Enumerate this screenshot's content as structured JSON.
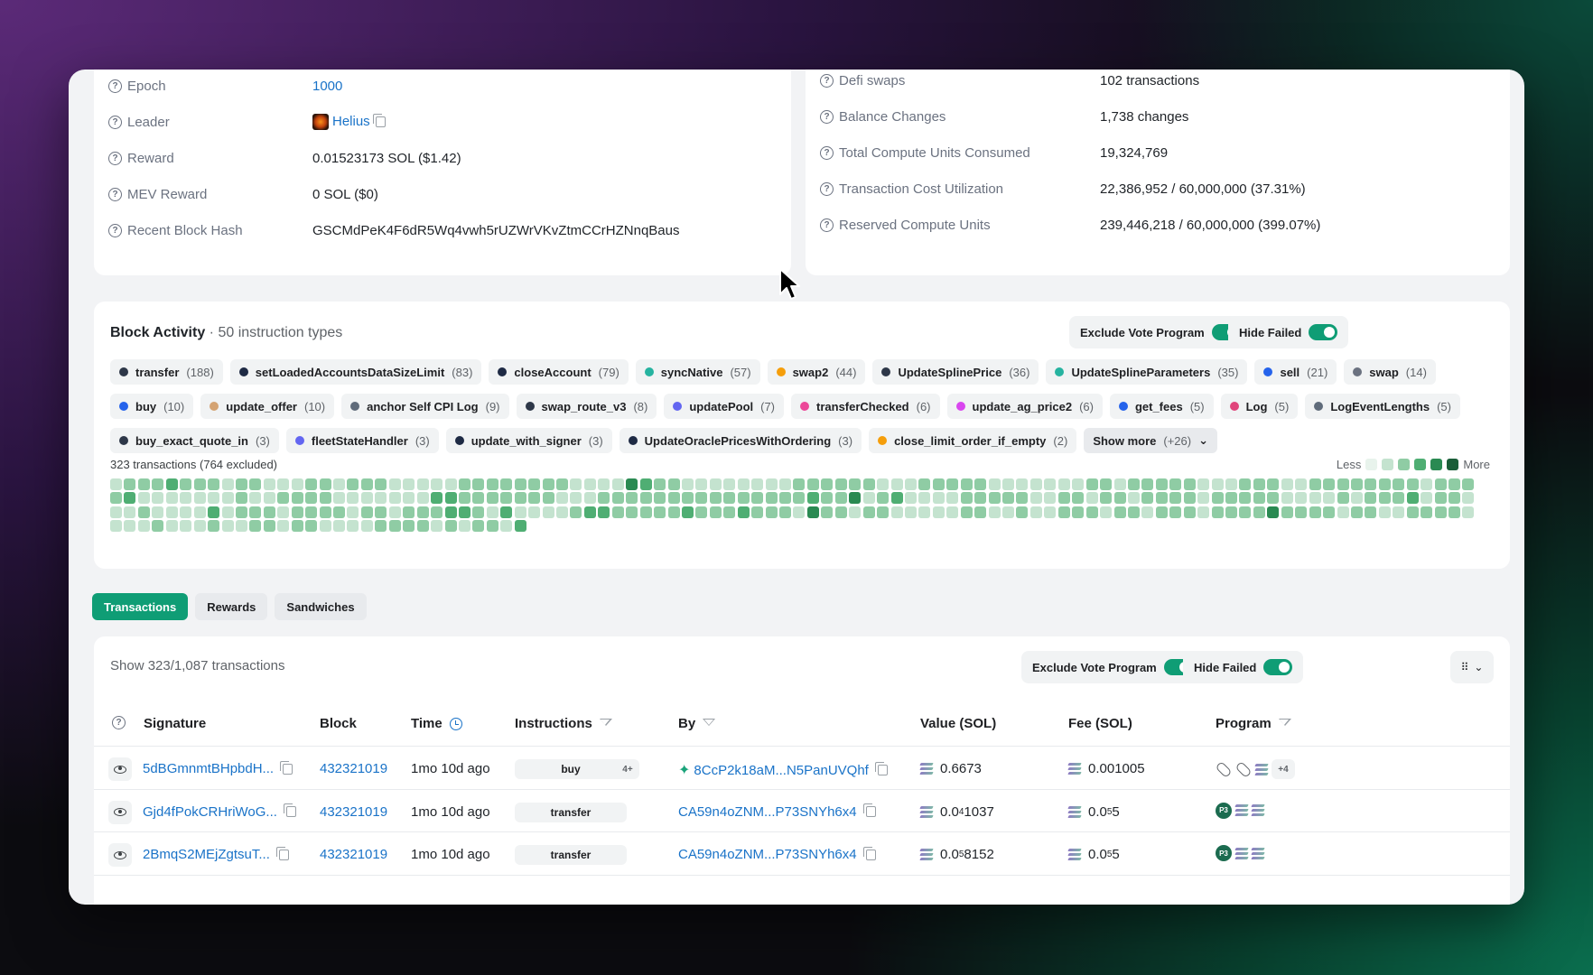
{
  "block_info_left": [
    {
      "label": "Epoch",
      "value": "1000",
      "link": true
    },
    {
      "label": "Leader",
      "value": "Helius",
      "link": true,
      "logo": true,
      "copy": true
    },
    {
      "label": "Reward",
      "value": "0.01523173 SOL ($1.42)"
    },
    {
      "label": "MEV Reward",
      "value": "0 SOL ($0)"
    },
    {
      "label": "Recent Block Hash",
      "value": "GSCMdPeK4F6dR5Wq4vwh5rUZWrVKvZtmCCrHZNnqBaus"
    }
  ],
  "block_info_right": [
    {
      "label": "Defi swaps",
      "value": "102 transactions"
    },
    {
      "label": "Balance Changes",
      "value": "1,738 changes"
    },
    {
      "label": "Total Compute Units Consumed",
      "value": "19,324,769"
    },
    {
      "label": "Transaction Cost Utilization",
      "value": "22,386,952 / 60,000,000 (37.31%)"
    },
    {
      "label": "Reserved Compute Units",
      "value": "239,446,218 / 60,000,000 (399.07%)"
    }
  ],
  "activity": {
    "title": "Block Activity",
    "subtitle": "· 50 instruction types",
    "exclude_vote_label": "Exclude Vote Program",
    "hide_failed_label": "Hide Failed",
    "summary": "323 transactions (764 excluded)",
    "legend_less": "Less",
    "legend_more": "More",
    "legend_colors": [
      "#e8f3ec",
      "#c4e3cf",
      "#8fcca4",
      "#4fae73",
      "#2a8a52",
      "#1a5e38"
    ],
    "chip_rows": [
      [
        {
          "name": "transfer",
          "count": "(188)",
          "color": "#2d3748"
        },
        {
          "name": "setLoadedAccountsDataSizeLimit",
          "count": "(83)",
          "color": "#1e2a44"
        },
        {
          "name": "closeAccount",
          "count": "(79)",
          "color": "#1e2a44"
        },
        {
          "name": "syncNative",
          "count": "(57)",
          "color": "#26b3a0"
        },
        {
          "name": "swap2",
          "count": "(44)",
          "color": "#f59e0b"
        },
        {
          "name": "UpdateSplinePrice",
          "count": "(36)",
          "color": "#2d3748"
        },
        {
          "name": "UpdateSplineParameters",
          "count": "(35)",
          "color": "#26b3a0"
        },
        {
          "name": "sell",
          "count": "(21)",
          "color": "#2563eb"
        },
        {
          "name": "swap",
          "count": "(14)",
          "color": "#6b7280"
        }
      ],
      [
        {
          "name": "buy",
          "count": "(10)",
          "color": "#2563eb"
        },
        {
          "name": "update_offer",
          "count": "(10)",
          "color": "#d4a373"
        },
        {
          "name": "anchor Self CPI Log",
          "count": "(9)",
          "color": "#5f6b7a"
        },
        {
          "name": "swap_route_v3",
          "count": "(8)",
          "color": "#2d3748"
        },
        {
          "name": "updatePool",
          "count": "(7)",
          "color": "#6366f1"
        },
        {
          "name": "transferChecked",
          "count": "(6)",
          "color": "#ec4899"
        },
        {
          "name": "update_ag_price2",
          "count": "(6)",
          "color": "#d946ef"
        },
        {
          "name": "get_fees",
          "count": "(5)",
          "color": "#2563eb"
        },
        {
          "name": "Log",
          "count": "(5)",
          "color": "#e0457b"
        },
        {
          "name": "LogEventLengths",
          "count": "(5)",
          "color": "#5f6b7a"
        }
      ],
      [
        {
          "name": "buy_exact_quote_in",
          "count": "(3)",
          "color": "#2d3748"
        },
        {
          "name": "fleetStateHandler",
          "count": "(3)",
          "color": "#6366f1"
        },
        {
          "name": "update_with_signer",
          "count": "(3)",
          "color": "#1e2a44"
        },
        {
          "name": "UpdateOraclePricesWithOrdering",
          "count": "(3)",
          "color": "#1e2a44"
        },
        {
          "name": "close_limit_order_if_empty",
          "count": "(2)",
          "color": "#f59e0b"
        }
      ]
    ],
    "show_more_label": "Show more",
    "show_more_count": "(+26)"
  },
  "tabs": [
    "Transactions",
    "Rewards",
    "Sandwiches"
  ],
  "active_tab": "Transactions",
  "transactions": {
    "show_text": "Show 323/1,087 transactions",
    "exclude_vote_label": "Exclude Vote Program",
    "hide_failed_label": "Hide Failed",
    "columns": [
      "Signature",
      "Block",
      "Time",
      "Instructions",
      "By",
      "Value (SOL)",
      "Fee (SOL)",
      "Program"
    ],
    "rows": [
      {
        "signature": "5dBGmnmtBHpbdH...",
        "block": "432321019",
        "time": "1mo 10d ago",
        "instruction": "buy",
        "extra_instr": "4+",
        "by": "8CcP2k18aM...N5PanUVQhf",
        "by_sparkle": true,
        "value_main": "0.6673",
        "value_sub": "",
        "value_tail": "",
        "fee_main": "0.001005",
        "fee_sub": "",
        "fee_tail": "",
        "programs": [
          "pill-icon",
          "pill-icon",
          "solana-icon"
        ],
        "programs_more": "+4"
      },
      {
        "signature": "Gjd4fPokCRHriWoG...",
        "block": "432321019",
        "time": "1mo 10d ago",
        "instruction": "transfer",
        "extra_instr": "",
        "by": "CA59n4oZNM...P73SNYh6x4",
        "by_sparkle": false,
        "value_main": "0.0",
        "value_sub": "4",
        "value_tail": "1037",
        "fee_main": "0.0",
        "fee_sub": "5",
        "fee_tail": "5",
        "programs": [
          "p3-icon",
          "solana-icon",
          "solana-icon"
        ],
        "programs_more": ""
      },
      {
        "signature": "2BmqS2MEjZgtsuT...",
        "block": "432321019",
        "time": "1mo 10d ago",
        "instruction": "transfer",
        "extra_instr": "",
        "by": "CA59n4oZNM...P73SNYh6x4",
        "by_sparkle": false,
        "value_main": "0.0",
        "value_sub": "5",
        "value_tail": "8152",
        "fee_main": "0.0",
        "fee_sub": "5",
        "fee_tail": "5",
        "programs": [
          "p3-icon",
          "solana-icon",
          "solana-icon"
        ],
        "programs_more": ""
      }
    ]
  },
  "heatmap_levels": [
    [
      1,
      2,
      2,
      2,
      3,
      2,
      2,
      2,
      1,
      2,
      2,
      1,
      1,
      1,
      2,
      2,
      1,
      2,
      2,
      2,
      1,
      1,
      1,
      1,
      1,
      2,
      2,
      2,
      2,
      2,
      2,
      2,
      2,
      1,
      1,
      1,
      1,
      4,
      3,
      2,
      2,
      1,
      1,
      1,
      1,
      1,
      1,
      1,
      1,
      2,
      2,
      2,
      2,
      2,
      2,
      1,
      1,
      1,
      2,
      2,
      2,
      2,
      2,
      1,
      1,
      1,
      1,
      1,
      1,
      1,
      2,
      2,
      1,
      2,
      2,
      2,
      2,
      2,
      1,
      1,
      1,
      2,
      2,
      2,
      1,
      1,
      2,
      2,
      2,
      2,
      2,
      2,
      2,
      2,
      1,
      2,
      2,
      2
    ],
    [
      2,
      3,
      1,
      1,
      1,
      1,
      1,
      1,
      1,
      2,
      1,
      1,
      2,
      2,
      2,
      2,
      1,
      1,
      1,
      1,
      1,
      1,
      1,
      3,
      3,
      2,
      2,
      2,
      2,
      2,
      2,
      2,
      1,
      1,
      1,
      2,
      2,
      2,
      2,
      2,
      2,
      2,
      2,
      2,
      2,
      2,
      2,
      2,
      2,
      2,
      3,
      2,
      2,
      4,
      1,
      2,
      3,
      1,
      1,
      1,
      1,
      2,
      2,
      2,
      2,
      2,
      1,
      1,
      2,
      2,
      1,
      2,
      2,
      1,
      2,
      2,
      2,
      2,
      1,
      2,
      2,
      2,
      2,
      2,
      1,
      1,
      1,
      1,
      2,
      1,
      2,
      2,
      2,
      3,
      1,
      2,
      2,
      1
    ],
    [
      1,
      1,
      2,
      1,
      1,
      1,
      1,
      3,
      1,
      2,
      2,
      2,
      1,
      2,
      2,
      2,
      2,
      1,
      2,
      2,
      1,
      2,
      2,
      2,
      3,
      3,
      2,
      1,
      3,
      1,
      1,
      1,
      1,
      2,
      3,
      3,
      2,
      2,
      2,
      2,
      2,
      3,
      2,
      2,
      2,
      3,
      2,
      2,
      2,
      1,
      4,
      2,
      2,
      1,
      2,
      2,
      1,
      1,
      1,
      1,
      1,
      2,
      2,
      1,
      1,
      2,
      1,
      1,
      2,
      2,
      2,
      1,
      2,
      2,
      1,
      2,
      2,
      2,
      1,
      2,
      2,
      2,
      2,
      4,
      2,
      2,
      2,
      2,
      1,
      2,
      2,
      1,
      1,
      2,
      2,
      2,
      2,
      1
    ],
    [
      1,
      1,
      1,
      2,
      1,
      1,
      1,
      2,
      1,
      1,
      2,
      2,
      1,
      2,
      2,
      1,
      1,
      1,
      1,
      2,
      2,
      2,
      2,
      1,
      2,
      1,
      2,
      2,
      1,
      3
    ]
  ]
}
